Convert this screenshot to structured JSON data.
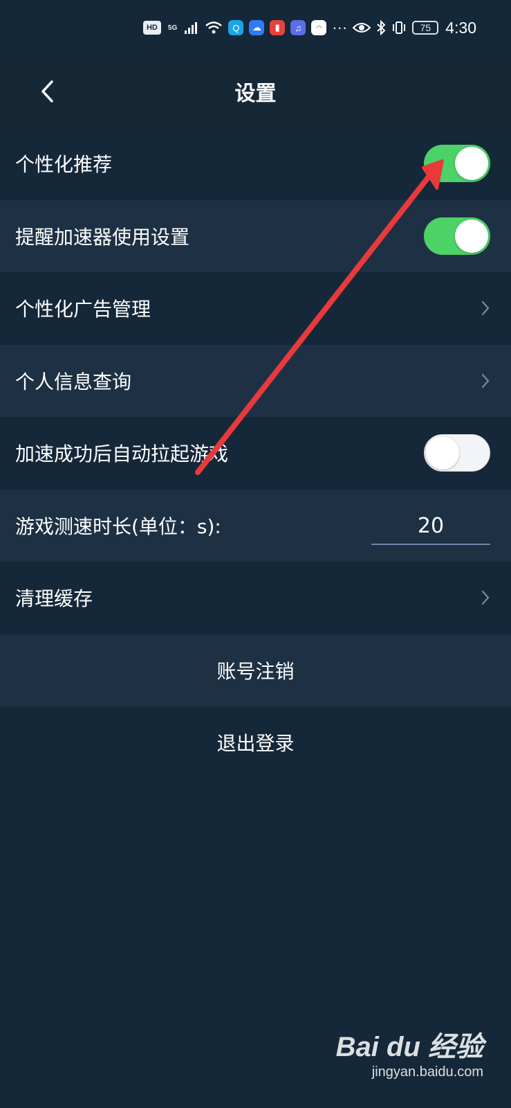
{
  "status_bar": {
    "badges": [
      "HD",
      "5G"
    ],
    "dots": "···",
    "battery": "75",
    "time": "4:30"
  },
  "header": {
    "title": "设置"
  },
  "settings": {
    "personalized_recommend": {
      "label": "个性化推荐",
      "enabled": true
    },
    "accelerator_reminder": {
      "label": "提醒加速器使用设置",
      "enabled": true
    },
    "ad_management": {
      "label": "个性化广告管理"
    },
    "personal_info": {
      "label": "个人信息查询"
    },
    "auto_launch_game": {
      "label": "加速成功后自动拉起游戏",
      "enabled": false
    },
    "speed_test": {
      "label": "游戏测速时长(单位：s):",
      "value": "20"
    },
    "clear_cache": {
      "label": "清理缓存"
    }
  },
  "actions": {
    "cancel_account": "账号注销",
    "logout": "退出登录"
  },
  "watermark": {
    "logo": "Bai du 经验",
    "url": "jingyan.baidu.com"
  },
  "colors": {
    "toggle_on": "#4cd266",
    "annotation_arrow": "#e8393c",
    "background": "#152839"
  }
}
